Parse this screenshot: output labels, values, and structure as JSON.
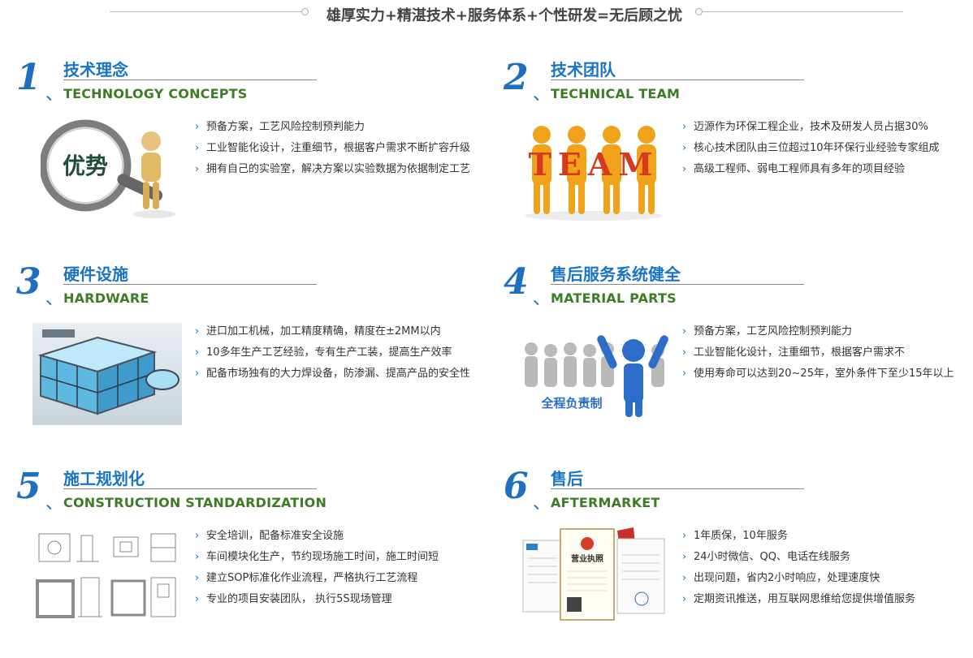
{
  "slogan": "雄厚实力+精湛技术+服务体系+个性研发=无后顾之忧",
  "sections": [
    {
      "number": "1",
      "title_cn": "技术理念",
      "title_en": "TECHNOLOGY CONCEPTS",
      "image_text": "优势",
      "bullets": [
        "预备方案，工艺风险控制预判能力",
        "工业智能化设计，注重细节，根据客户需求不断扩容升级",
        "拥有自己的实验室，解决方案以实验数据为依据制定工艺"
      ]
    },
    {
      "number": "2",
      "title_cn": "技术团队",
      "title_en": "TECHNICAL TEAM",
      "image_text": "TEAM",
      "bullets": [
        "迈源作为环保工程企业，技术及研发人员占据30%",
        "核心技术团队由三位超过10年环保行业经验专家组成",
        "高级工程师、弱电工程师具有多年的项目经验"
      ]
    },
    {
      "number": "3",
      "title_cn": "硬件设施",
      "title_en": "HARDWARE",
      "bullets": [
        "进口加工机械，加工精度精确，精度在±2MM以内",
        "10多年生产工艺经验，专有生产工装，提高生产效率",
        "配备市场独有的大力焊设备，防渗漏、提高产品的安全性"
      ]
    },
    {
      "number": "4",
      "title_cn": "售后服务系统健全",
      "title_en": "MATERIAL PARTS",
      "image_text": "全程负责制",
      "bullets": [
        "预备方案，工艺风险控制预判能力",
        "工业智能化设计，注重细节，根据客户需求不",
        "使用寿命可以达到20~25年，室外条件下至少15年以上"
      ]
    },
    {
      "number": "5",
      "title_cn": "施工规划化",
      "title_en": "CONSTRUCTION STANDARDIZATION",
      "bullets": [
        "安全培训，配备标准安全设施",
        "车间模块化生产，节约现场施工时间，施工时间短",
        "建立SOP标准化作业流程，严格执行工艺流程",
        "专业的项目安装团队， 执行5S现场管理"
      ]
    },
    {
      "number": "6",
      "title_cn": "售后",
      "title_en": "AFTERMARKET",
      "image_text": "营业执照",
      "bullets": [
        "1年质保，10年服务",
        "24小时微信、QQ、电话在线服务",
        "出现问题，省内2小时响应，处理速度快",
        "定期资讯推送，用互联网思维给您提供增值服务"
      ]
    }
  ]
}
